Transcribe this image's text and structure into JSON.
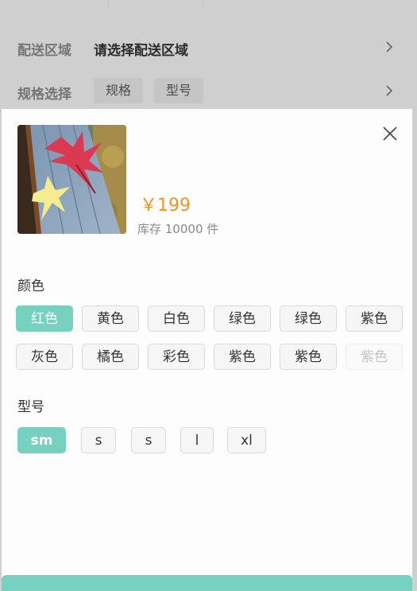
{
  "background": {
    "delivery": {
      "label": "配送区域",
      "value": "请选择配送区域"
    },
    "spec": {
      "label": "规格选择",
      "tags": [
        "规格",
        "型号"
      ]
    }
  },
  "product": {
    "price": "￥199",
    "stock": "库存 10000 件"
  },
  "color_section": {
    "title": "颜色",
    "options": [
      {
        "label": "红色",
        "state": "active"
      },
      {
        "label": "黄色",
        "state": "normal"
      },
      {
        "label": "白色",
        "state": "normal"
      },
      {
        "label": "绿色",
        "state": "normal"
      },
      {
        "label": "绿色",
        "state": "normal"
      },
      {
        "label": "紫色",
        "state": "normal"
      },
      {
        "label": "灰色",
        "state": "normal"
      },
      {
        "label": "橘色",
        "state": "normal"
      },
      {
        "label": "彩色",
        "state": "normal"
      },
      {
        "label": "紫色",
        "state": "normal"
      },
      {
        "label": "紫色",
        "state": "normal"
      },
      {
        "label": "紫色",
        "state": "disabled"
      }
    ]
  },
  "model_section": {
    "title": "型号",
    "options": [
      {
        "label": "sm",
        "state": "active"
      },
      {
        "label": "s",
        "state": "normal"
      },
      {
        "label": "s",
        "state": "normal"
      },
      {
        "label": "l",
        "state": "normal"
      },
      {
        "label": "xl",
        "state": "normal"
      }
    ]
  },
  "colors": {
    "accent": "#76d1c0",
    "price": "#f39324",
    "overlay": "#cfcfcf"
  },
  "icons": {
    "close": "close-icon",
    "chevron": "chevron-right-icon"
  }
}
